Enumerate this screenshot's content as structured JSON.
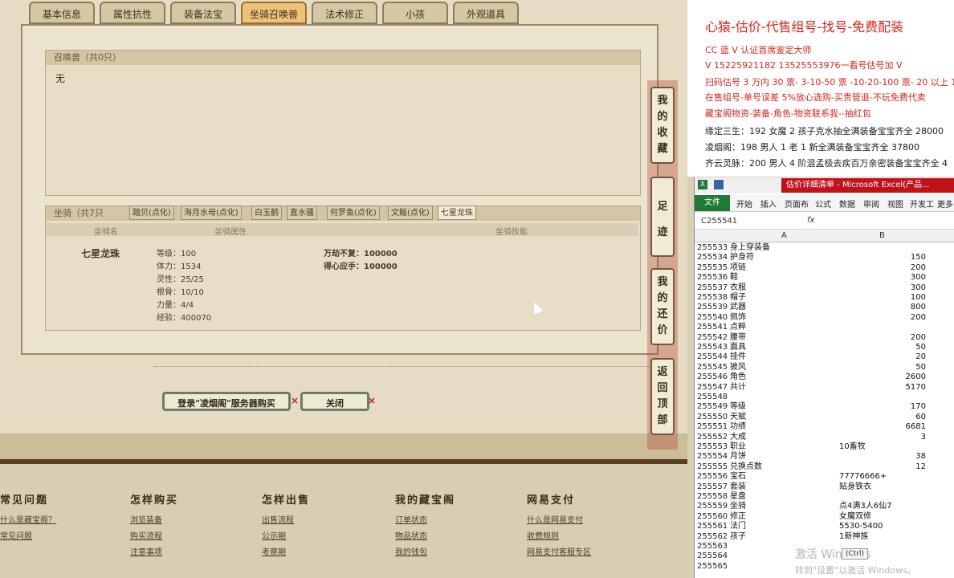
{
  "tabs": [
    "基本信息",
    "属性抗性",
    "装备法宝",
    "坐骑召唤兽",
    "法术修正",
    "小孩",
    "外观道具"
  ],
  "summon": {
    "header": "召唤兽（共0只）",
    "body": "无"
  },
  "mount": {
    "header": "坐骑（共7只",
    "tabs": [
      "踏贝(点化)",
      "海月水母(点化)",
      "白玉鹤",
      "直水骚",
      "何罗鱼(点化)",
      "文鳐(点化)",
      "七星龙珠"
    ],
    "col_name": "坐骑名",
    "col_attr": "坐骑属性",
    "col_skill": "坐骑技能",
    "name": "七星龙珠",
    "attrs": [
      "等级：100",
      "体力：1534",
      "灵性：25/25",
      "根骨：10/10",
      "力量：4/4",
      "经验：400070"
    ],
    "skills": [
      "万劫不复：100000",
      "得心应手：100000"
    ]
  },
  "buttons": {
    "buy": "登录\"凌烟阁\"服务器购买",
    "close": "关闭",
    "x": "×"
  },
  "side_buttons": [
    [
      "我",
      "的",
      "收",
      "藏"
    ],
    [
      "足",
      "迹"
    ],
    [
      "我",
      "的",
      "还",
      "价"
    ],
    [
      "返",
      "回",
      "顶",
      "部"
    ]
  ],
  "footer": [
    {
      "h": "常见问题",
      "links": [
        "什么是藏宝阁？",
        "常见问题"
      ]
    },
    {
      "h": "怎样购买",
      "links": [
        "浏览装备",
        "购买流程",
        "注意事项"
      ]
    },
    {
      "h": "怎样出售",
      "links": [
        "出售流程",
        "公示期",
        "考察期"
      ]
    },
    {
      "h": "我的藏宝阁",
      "links": [
        "订单状态",
        "物品状态",
        "我的钱包"
      ]
    },
    {
      "h": "网易支付",
      "links": [
        "什么是网易支付",
        "收费规则",
        "网易支付客服专区"
      ]
    }
  ],
  "ad": {
    "title": "心猿-估价-代售组号-找号-免费配装",
    "lines": [
      {
        "t": "CC 蓝 V 认证首席鉴定大师",
        "c": "red"
      },
      {
        "t": "V 15225921182     13525553976一看号估号加 V",
        "c": "red"
      },
      {
        "t": "扫码估号 3 万内 30 票- 3-10-50 票  -10-20-100 票- 20 以上 150",
        "c": "red"
      },
      {
        "t": "在售组号-单号误差 5%放心选购-买贵管退-不玩免费代卖",
        "c": "red"
      },
      {
        "t": "藏宝阁物资-装备-角色-物资联系我--抽红包",
        "c": "red"
      },
      {
        "t": "缘定三生：192 女魔 2 孩子克水抽全满装备宝宝齐全 28000",
        "c": "blk"
      },
      {
        "t": "凌烟阁：198 男人 1 老 1 新全满装备宝宝齐全 37800",
        "c": "blk"
      },
      {
        "t": "齐云灵脉：200 男人 4 阶混孟极去疾百万亲密装备宝宝齐全 4",
        "c": "blk"
      }
    ]
  },
  "excel": {
    "title": "估价详细清单 - Microsoft Excel(产品...",
    "ribbon": [
      "文件",
      "开始",
      "插入",
      "页面布",
      "公式",
      "数据",
      "审阅",
      "视图",
      "开发工",
      "更多"
    ],
    "namebox": "C255541",
    "fx": "fx",
    "cols": [
      "A",
      "B"
    ],
    "rows": [
      [
        "255533",
        "身上穿装备",
        ""
      ],
      [
        "255534",
        "护身符",
        "150"
      ],
      [
        "255535",
        "项链",
        "200"
      ],
      [
        "255536",
        "鞋",
        "300"
      ],
      [
        "255537",
        "衣服",
        "300"
      ],
      [
        "255538",
        "帽子",
        "100"
      ],
      [
        "255539",
        "武器",
        "800"
      ],
      [
        "255540",
        "佩饰",
        "200"
      ],
      [
        "255541",
        "点粹",
        ""
      ],
      [
        "255542",
        "腰带",
        "200"
      ],
      [
        "255543",
        "面具",
        "50"
      ],
      [
        "255544",
        "挂件",
        "20"
      ],
      [
        "255545",
        "披风",
        "50"
      ],
      [
        "255546",
        "角色",
        "2600"
      ],
      [
        "255547",
        "共计",
        "5170"
      ],
      [
        "255548",
        "",
        ""
      ],
      [
        "255549",
        "等级",
        "170"
      ],
      [
        "255550",
        "天赋",
        "60"
      ],
      [
        "255551",
        "功绩",
        "6681"
      ],
      [
        "255552",
        "大成",
        "3"
      ],
      [
        "255553",
        "职业",
        "10畜牧",
        "L"
      ],
      [
        "255554",
        "月饼",
        "38"
      ],
      [
        "255555",
        "兑换点数",
        "12"
      ],
      [
        "255556",
        "宝石",
        "77776666+",
        "L"
      ],
      [
        "255557",
        "套装",
        "贴身铁衣",
        "L"
      ],
      [
        "255558",
        "星盘",
        ""
      ],
      [
        "255559",
        "坐骑",
        "点4满3人6仙7",
        "L"
      ],
      [
        "255560",
        "修正",
        "女魔双修",
        "L"
      ],
      [
        "255561",
        "法门",
        "5530-5400",
        "L"
      ],
      [
        "255562",
        "孩子",
        "1新神族",
        "L"
      ],
      [
        "255563",
        "",
        ""
      ],
      [
        "255564",
        "",
        ""
      ],
      [
        "255565",
        "",
        ""
      ]
    ],
    "paste": "(Ctrl)",
    "watermark": "激活 Windows",
    "watermark2": "转到\"设置\"以激活 Windows。"
  }
}
